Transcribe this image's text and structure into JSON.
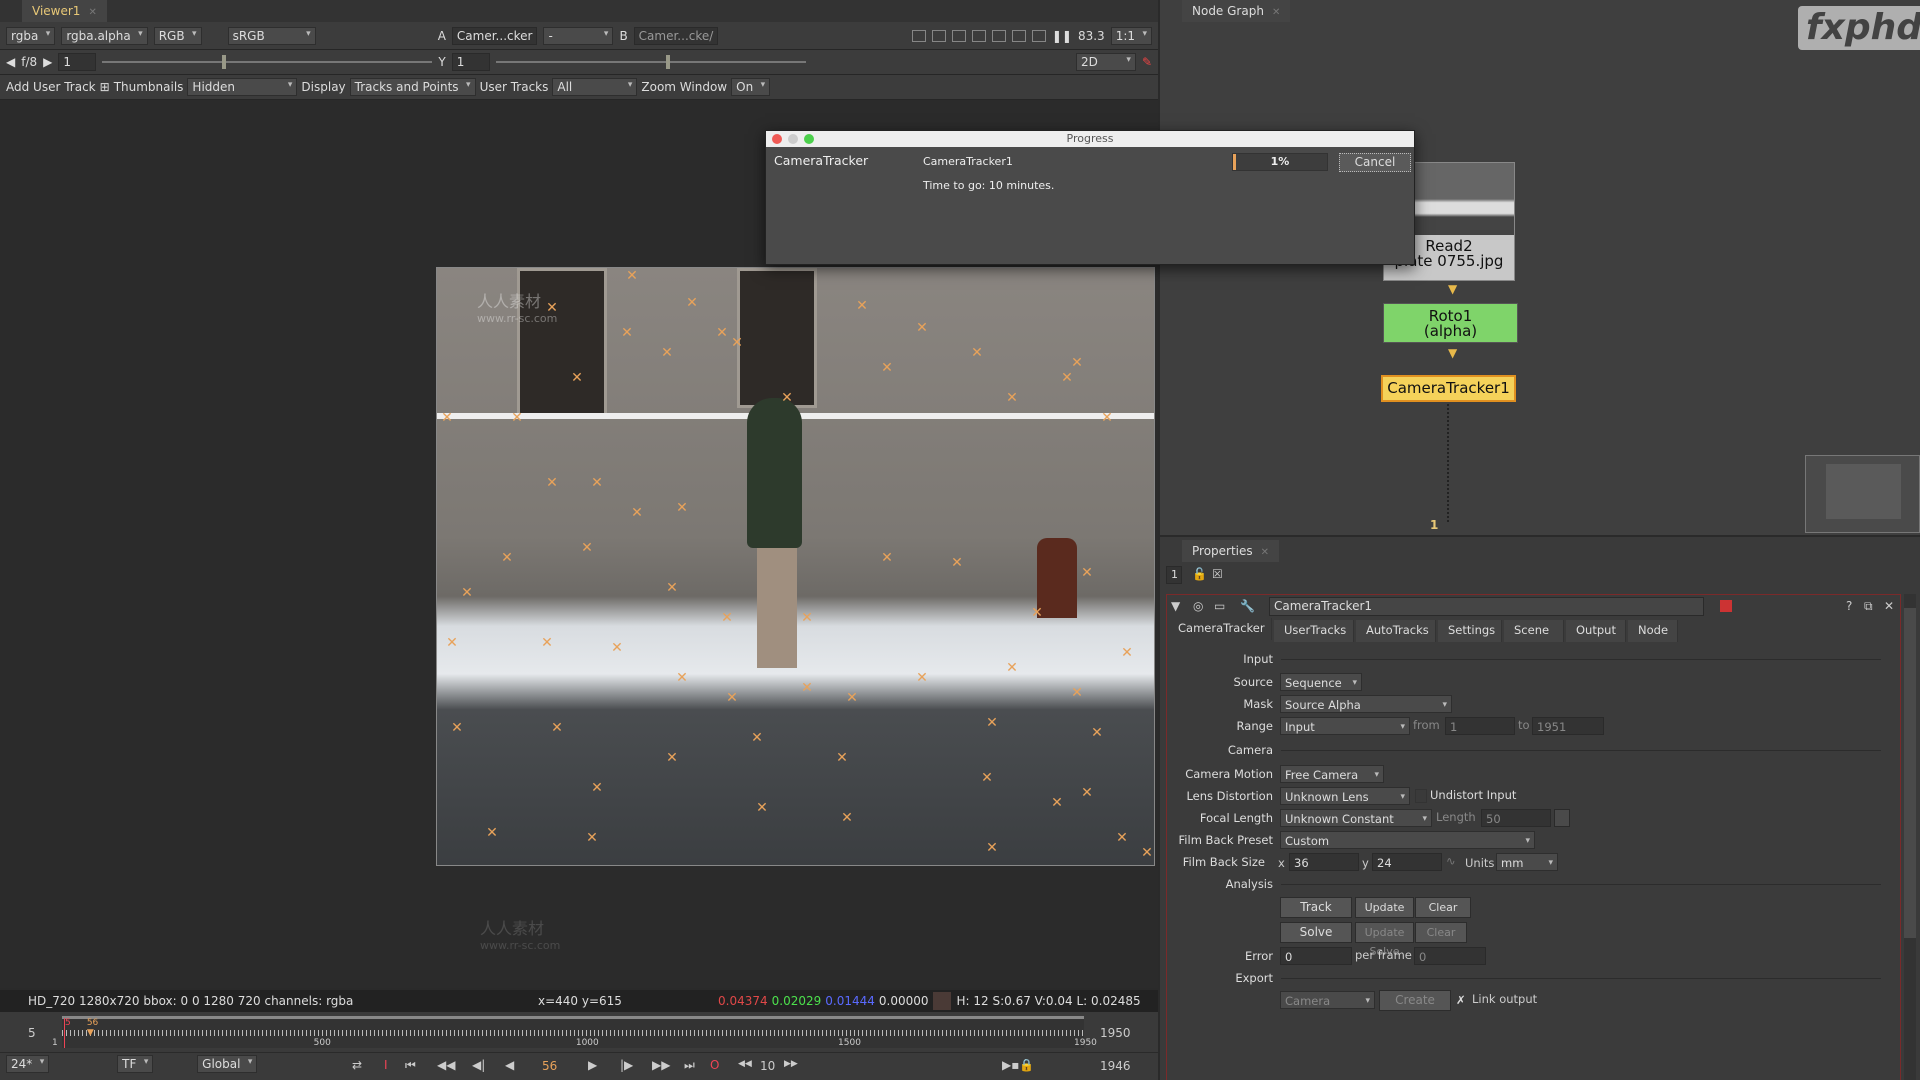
{
  "viewer": {
    "tab": "Viewer1",
    "channels": "rgba",
    "alpha": "rgba.alpha",
    "color": "RGB",
    "lut": "sRGB",
    "input_a_label": "A",
    "input_a": "Camer...cker",
    "ab_mode": "-",
    "input_b_label": "B",
    "input_b": "Camer...cke/",
    "gain_label": "f/8",
    "gain": "1",
    "gamma_label": "Y",
    "gamma": "1",
    "zoom_pct": "83.3",
    "ratio": "1:1",
    "view_mode": "2D",
    "toolbar": {
      "add_user_track": "Add User Track",
      "thumbnails_label": "Thumbnails",
      "thumbnails": "Hidden",
      "display_label": "Display",
      "display": "Tracks and Points",
      "user_tracks_label": "User Tracks",
      "user_tracks": "All",
      "zoom_window_label": "Zoom Window",
      "zoom_window": "On"
    },
    "watermark": "人人素材",
    "watermark_url": "www.rr-sc.com"
  },
  "progress": {
    "title": "Progress",
    "task": "CameraTracker",
    "node": "CameraTracker1",
    "eta": "Time to go: 10 minutes.",
    "percent_text": "1%",
    "percent": 1,
    "cancel": "Cancel"
  },
  "status": {
    "format": "HD_720 1280x720  bbox: 0 0 1280 720 channels: rgba",
    "coords": "x=440 y=615",
    "r": "0.04374",
    "g": "0.02029",
    "b": "0.01444",
    "a": "0.00000",
    "hsvl": "H: 12 S:0.67 V:0.04  L: 0.02485"
  },
  "timeline": {
    "start": "5",
    "in_mark": "5",
    "current": "56",
    "ticks": [
      "1",
      "500",
      "1000",
      "1500",
      "1950"
    ],
    "end": "1950",
    "first": 1,
    "last": 1950,
    "current_frame": 56
  },
  "controls": {
    "fps": "24*",
    "tf": "TF",
    "scope": "Global",
    "frame": "56",
    "step": "10",
    "end_frame": "1946"
  },
  "node_graph": {
    "tab": "Node Graph",
    "logo": "fxphd",
    "nodes": [
      {
        "name": "Read2",
        "sub": "plate 0755.jpg"
      },
      {
        "name": "Roto1",
        "sub": "(alpha)"
      },
      {
        "name": "CameraTracker1"
      }
    ],
    "output_label": "1"
  },
  "properties": {
    "tab": "Properties",
    "count": "1",
    "node_name": "CameraTracker1",
    "tabs": [
      "CameraTracker",
      "UserTracks",
      "AutoTracks",
      "Settings",
      "Scene",
      "Output",
      "Node"
    ],
    "input": "Input",
    "source_label": "Source",
    "source": "Sequence",
    "mask_label": "Mask",
    "mask": "Source Alpha",
    "range_label": "Range",
    "range": "Input",
    "from_label": "from",
    "from": "1",
    "to_label": "to",
    "to": "1951",
    "camera": "Camera",
    "motion_label": "Camera Motion",
    "motion": "Free Camera",
    "lens_label": "Lens Distortion",
    "lens": "Unknown Lens",
    "undistort": "Undistort Input",
    "focal_label": "Focal Length",
    "focal": "Unknown Constant",
    "length_label": "Length",
    "length": "50",
    "preset_label": "Film Back Preset",
    "preset": "Custom",
    "size_label": "Film Back Size",
    "x_label": "x",
    "x": "36",
    "y_label": "y",
    "y": "24",
    "units_label": "Units",
    "units": "mm",
    "analysis": "Analysis",
    "track": "Track",
    "update_track": "Update Track",
    "clear_tracks": "Clear Tracks",
    "solve": "Solve",
    "update_solve": "Update Solve",
    "clear_solve": "Clear Solve",
    "error_label": "Error",
    "error": "0",
    "per_frame_label": "per frame",
    "per_frame": "0",
    "export": "Export",
    "export_type": "Camera",
    "create": "Create",
    "link_output": "Link output",
    "link_checked": true
  },
  "colors": {
    "accent": "#e8a25a",
    "selected_node": "#f5d25a",
    "roto_node": "#7fd46a",
    "read_node": "#c8c8c8"
  }
}
